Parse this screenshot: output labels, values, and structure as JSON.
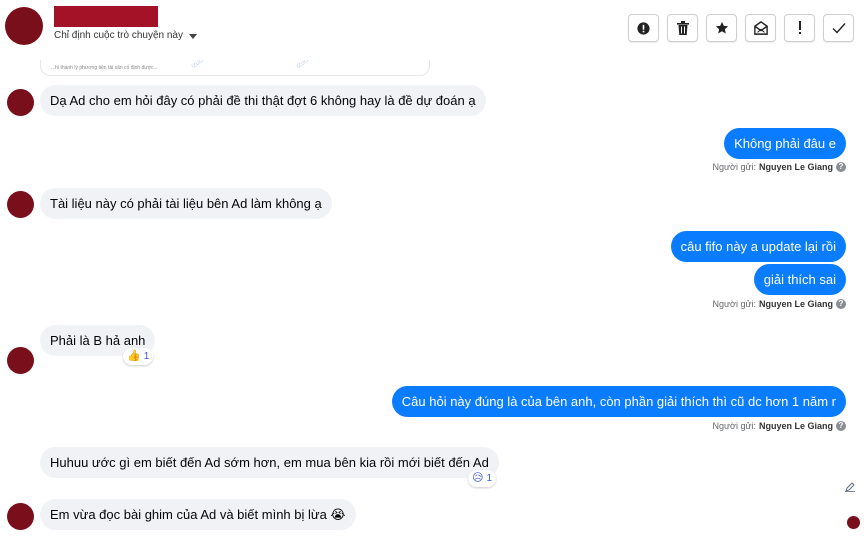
{
  "header": {
    "assign_label": "Chỉ định cuộc trò chuyện này",
    "toolbar": [
      {
        "name": "report-button",
        "icon": "alert-circle-icon"
      },
      {
        "name": "delete-button",
        "icon": "trash-icon"
      },
      {
        "name": "star-button",
        "icon": "star-icon"
      },
      {
        "name": "archive-button",
        "icon": "archive-mail-icon"
      },
      {
        "name": "important-button",
        "icon": "exclamation-icon"
      },
      {
        "name": "done-button",
        "icon": "check-icon"
      }
    ]
  },
  "preview": {
    "text": "...hi thanh lý phương tiện tài sản cố định được...",
    "watermark": "izuo"
  },
  "messages": {
    "m1": "Dạ Ad cho em hỏi đây có phải đề thi thật đợt 6 không hay là đề dự đoán ạ",
    "m2": "Không phải đâu e",
    "m3": "Tài liệu này có phải tài liệu bên Ad làm không ạ",
    "m4": "câu fifo này a update lại rồi",
    "m5": "giải thích sai",
    "m6": "Phải là B hả anh",
    "m7": "Câu hỏi này đúng là của bên anh, còn phần giải thích thì cũ dc hơn 1 năm r",
    "m8": "Huhuu ước gì em biết đến Ad sớm hơn, em mua bên kia rồi mới biết đến Ad",
    "m9": "Em vừa đọc bài ghim của Ad và biết mình bị lừa 😭"
  },
  "sender": {
    "prefix": "Người gửi:",
    "name": "Nguyen Le Giang"
  },
  "reactions": {
    "r1": {
      "emoji": "👍",
      "count": "1"
    },
    "r2": {
      "emoji": "😥",
      "count": "1"
    }
  },
  "colors": {
    "outgoing_bubble": "#0a7cff",
    "incoming_bubble": "#f0f2f5",
    "redaction": "#a31227",
    "avatar": "#7a0f1c"
  }
}
